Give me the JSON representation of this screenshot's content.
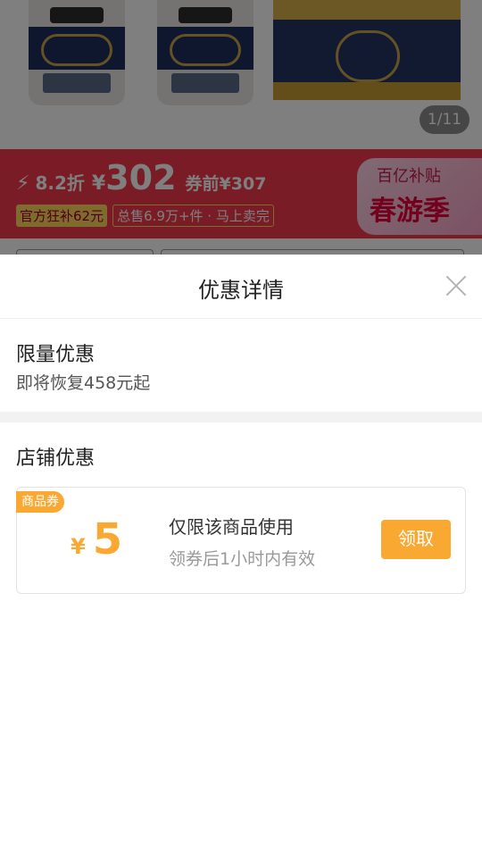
{
  "gallery": {
    "counter": "1/11"
  },
  "promo": {
    "bolt_icon": "lightning-icon",
    "discount": "8.2折",
    "currency": "¥",
    "price": "302",
    "before_price": "券前¥307",
    "tags": [
      "官方狂补62元",
      "总售6.9万+件 · 马上卖完"
    ],
    "subsidy_top": "百亿补贴",
    "subsidy_main": "春游季",
    "color": "#f2394a"
  },
  "sheet": {
    "title": "优惠详情",
    "close_icon": "close-icon",
    "limited": {
      "title": "限量优惠",
      "subtitle": "即将恢复458元起"
    },
    "shop": {
      "title": "店铺优惠",
      "coupon": {
        "tag": "商品券",
        "currency": "¥",
        "amount": "5",
        "line1": "仅限该商品使用",
        "line2": "领券后1小时内有效",
        "button": "领取",
        "accent": "#f9a832"
      }
    }
  }
}
